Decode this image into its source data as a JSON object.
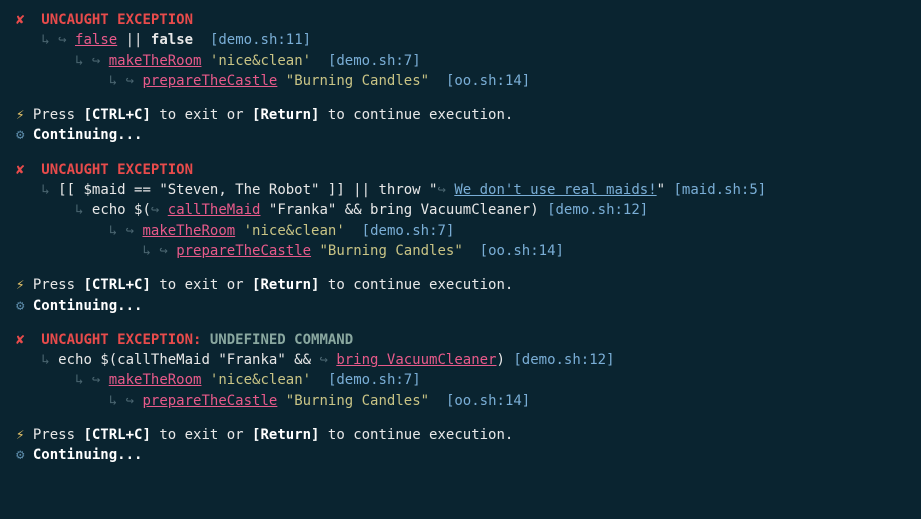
{
  "icons": {
    "cross": "✘",
    "branch": "↳",
    "arrow": "↪",
    "bolt": "⚡",
    "gear": "⚙"
  },
  "headers": {
    "uncaught": "UNCAUGHT EXCEPTION",
    "uncaught_colon": "UNCAUGHT EXCEPTION:",
    "undefined_cmd": "UNDEFINED COMMAND"
  },
  "blocks": [
    {
      "trace": [
        {
          "indent": 1,
          "pre": "",
          "link": "false",
          "post": " || ",
          "bold": "false",
          "str": "",
          "loc": "[demo.sh:11]"
        },
        {
          "indent": 2,
          "pre": "",
          "link": "makeTheRoom",
          "post": " ",
          "bold": "",
          "str": "'nice&clean'",
          "loc": "[demo.sh:7]"
        },
        {
          "indent": 3,
          "pre": "",
          "link": "prepareTheCastle",
          "post": " ",
          "bold": "",
          "str": "\"Burning Candles\"",
          "loc": "[oo.sh:14]"
        }
      ]
    },
    {
      "trace": [
        {
          "indent": 1,
          "pre": "[[ $maid == \"Steven, The Robot\" ]] || throw \"",
          "link": "",
          "bluelink": "We don't use real maids!",
          "post": "\"",
          "bold": "",
          "str": "",
          "loc": "[maid.sh:5]",
          "linkarrow": true
        },
        {
          "indent": 2,
          "pre": "echo $(",
          "link": "callTheMaid",
          "post": " \"Franka\" && bring VacuumCleaner)",
          "bold": "",
          "str": "",
          "loc": "[demo.sh:12]",
          "linkarrow": true
        },
        {
          "indent": 3,
          "pre": "",
          "link": "makeTheRoom",
          "post": " ",
          "bold": "",
          "str": "'nice&clean'",
          "loc": "[demo.sh:7]"
        },
        {
          "indent": 4,
          "pre": "",
          "link": "prepareTheCastle",
          "post": " ",
          "bold": "",
          "str": "\"Burning Candles\"",
          "loc": "[oo.sh:14]"
        }
      ]
    },
    {
      "header_extra": true,
      "trace": [
        {
          "indent": 1,
          "pre": "echo $(callTheMaid \"Franka\" && ",
          "link": "bring VacuumCleaner",
          "post": ")",
          "bold": "",
          "str": "",
          "loc": "[demo.sh:12]",
          "linkarrow": true
        },
        {
          "indent": 2,
          "pre": "",
          "link": "makeTheRoom",
          "post": " ",
          "bold": "",
          "str": "'nice&clean'",
          "loc": "[demo.sh:7]"
        },
        {
          "indent": 3,
          "pre": "",
          "link": "prepareTheCastle",
          "post": " ",
          "bold": "",
          "str": "\"Burning Candles\"",
          "loc": "[oo.sh:14]"
        }
      ]
    }
  ],
  "prompt": {
    "press": "Press ",
    "ctrlc": "[CTRL+C]",
    "toexit": " to exit or ",
    "ret": "[Return]",
    "cont": " to continue execution."
  },
  "continuing": "Continuing..."
}
